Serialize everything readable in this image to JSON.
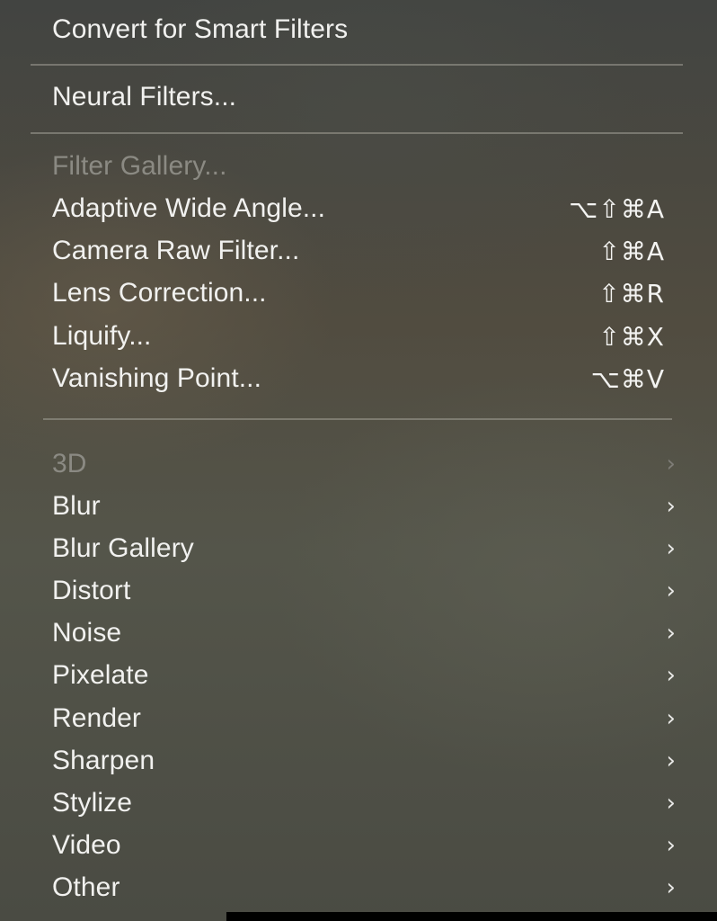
{
  "menu": {
    "top_items": [
      {
        "label": "Convert for Smart Filters"
      },
      {
        "label": "Neural Filters..."
      }
    ],
    "filter_items": [
      {
        "label": "Filter Gallery...",
        "shortcut": "",
        "disabled": true
      },
      {
        "label": "Adaptive Wide Angle...",
        "shortcut": "⌥⇧⌘A",
        "disabled": false
      },
      {
        "label": "Camera Raw Filter...",
        "shortcut": "⇧⌘A",
        "disabled": false
      },
      {
        "label": "Lens Correction...",
        "shortcut": "⇧⌘R",
        "disabled": false
      },
      {
        "label": "Liquify...",
        "shortcut": "⇧⌘X",
        "disabled": false
      },
      {
        "label": "Vanishing Point...",
        "shortcut": "⌥⌘V",
        "disabled": false
      }
    ],
    "submenus": [
      {
        "label": "3D",
        "disabled": true
      },
      {
        "label": "Blur",
        "disabled": false
      },
      {
        "label": "Blur Gallery",
        "disabled": false
      },
      {
        "label": "Distort",
        "disabled": false
      },
      {
        "label": "Noise",
        "disabled": false
      },
      {
        "label": "Pixelate",
        "disabled": false
      },
      {
        "label": "Render",
        "disabled": false
      },
      {
        "label": "Sharpen",
        "disabled": false
      },
      {
        "label": "Stylize",
        "disabled": false
      },
      {
        "label": "Video",
        "disabled": false
      },
      {
        "label": "Other",
        "disabled": false
      }
    ],
    "chevron_glyph": "›"
  }
}
